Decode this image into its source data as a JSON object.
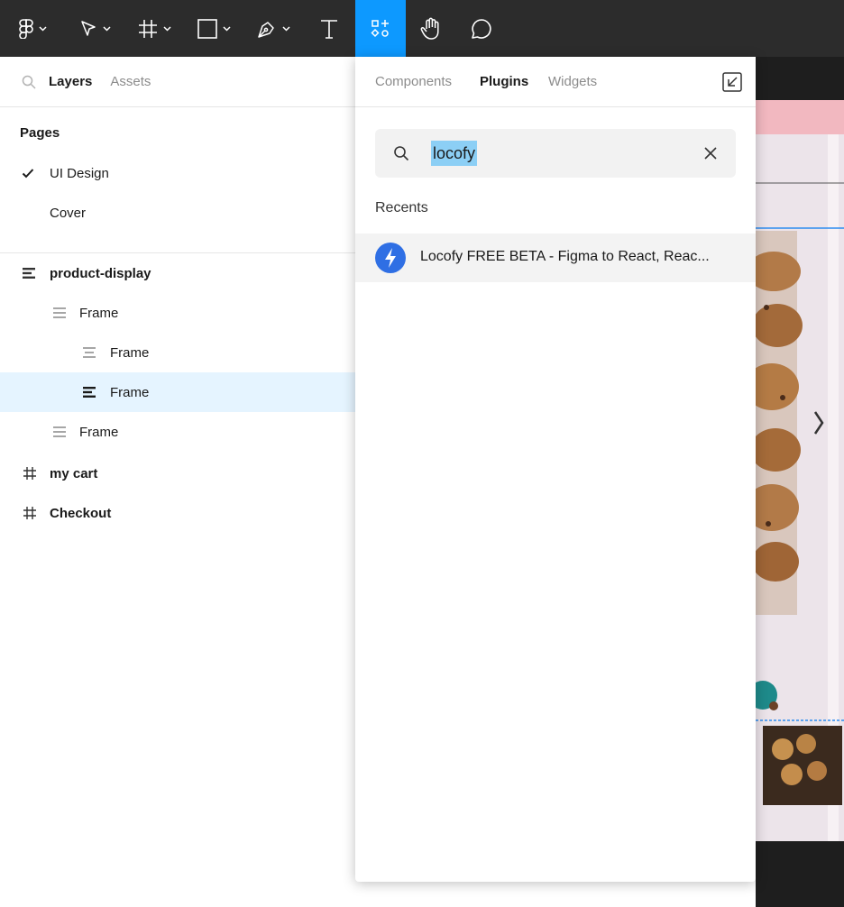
{
  "toolbar": {
    "tools": [
      "figma-menu",
      "move",
      "frame",
      "shape",
      "pen",
      "text",
      "resources",
      "hand",
      "comment"
    ],
    "active_tool": "resources",
    "active_color": "#0d99ff"
  },
  "left_panel": {
    "tabs": [
      {
        "label": "Layers",
        "active": true
      },
      {
        "label": "Assets",
        "active": false
      }
    ],
    "pages_title": "Pages",
    "pages": [
      {
        "label": "UI Design",
        "current": true
      },
      {
        "label": "Cover",
        "current": false
      }
    ],
    "layers": [
      {
        "label": "product-display",
        "type": "auto-layout",
        "level": 0,
        "bold": true,
        "selected": false
      },
      {
        "label": "Frame",
        "type": "auto-layout",
        "level": 1,
        "bold": false,
        "selected": false
      },
      {
        "label": "Frame",
        "type": "auto-layout",
        "level": 2,
        "bold": false,
        "selected": false
      },
      {
        "label": "Frame",
        "type": "auto-layout",
        "level": 2,
        "bold": false,
        "selected": true
      },
      {
        "label": "Frame",
        "type": "auto-layout",
        "level": 1,
        "bold": false,
        "selected": false
      },
      {
        "label": "my cart",
        "type": "frame",
        "level": 0,
        "bold": true,
        "selected": false
      },
      {
        "label": "Checkout",
        "type": "frame",
        "level": 0,
        "bold": true,
        "selected": false
      }
    ]
  },
  "popover": {
    "tabs": [
      {
        "label": "Components",
        "active": false
      },
      {
        "label": "Plugins",
        "active": true
      },
      {
        "label": "Widgets",
        "active": false
      }
    ],
    "search": {
      "value": "locofy",
      "highlight_color": "#8ccff5"
    },
    "recents_title": "Recents",
    "results": [
      {
        "label": "Locofy FREE BETA - Figma to React, Reac...",
        "icon": "lightning-icon",
        "icon_color": "#2f6fe4"
      }
    ]
  }
}
